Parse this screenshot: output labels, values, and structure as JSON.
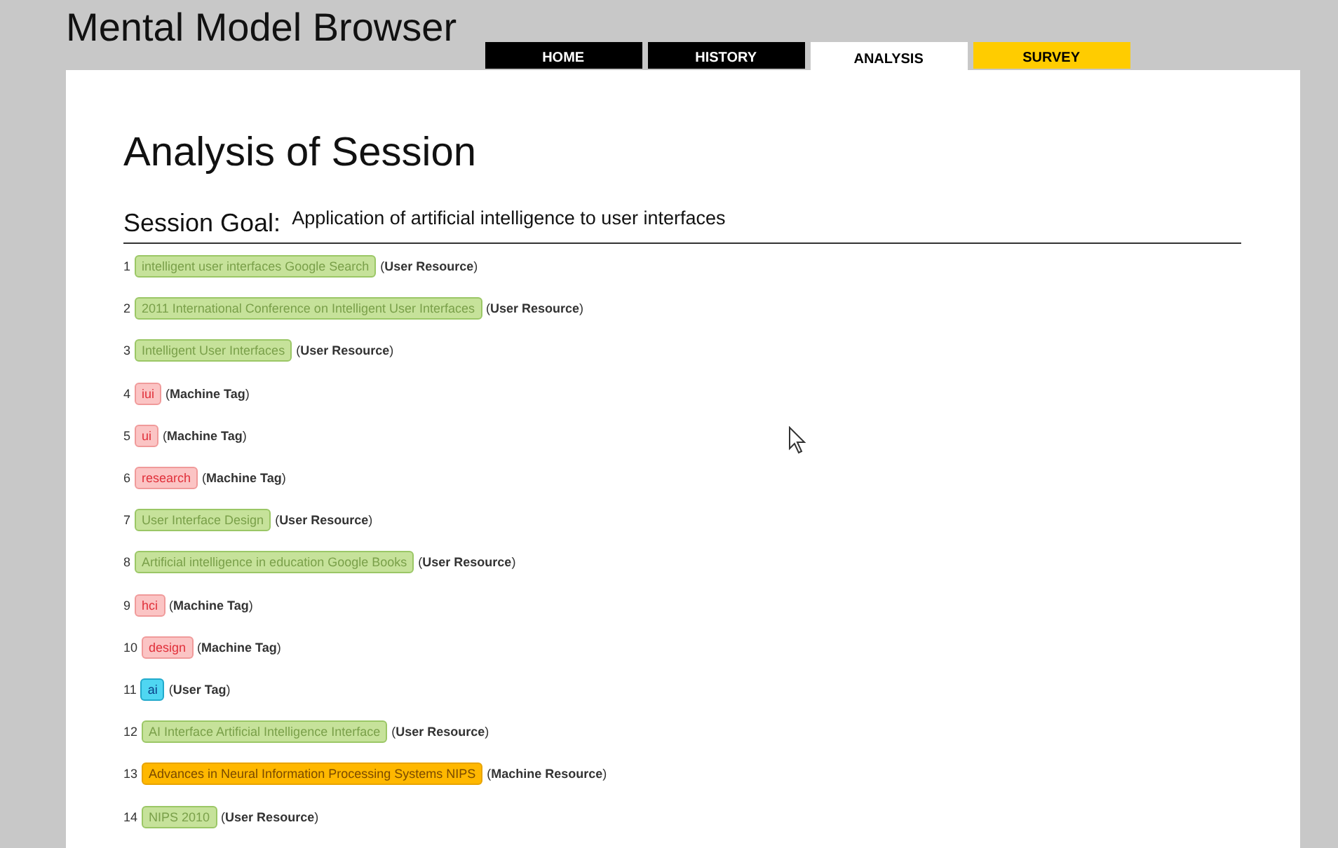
{
  "header": {
    "title": "Mental Model Browser"
  },
  "tabs": [
    {
      "label": "HOME",
      "selected": false,
      "color": "#000000"
    },
    {
      "label": "HISTORY",
      "selected": false,
      "color": "#000000"
    },
    {
      "label": "ANALYSIS",
      "selected": true
    },
    {
      "label": "SURVEY",
      "selected": false,
      "color": "#ffcc00"
    }
  ],
  "heading": "Analysis of Session",
  "session_goal": {
    "label": "Session Goal:",
    "value": "Application of artificial intelligence to user interfaces"
  },
  "items": [
    {
      "number": "1",
      "text": "intelligent user interfaces Google Search",
      "kind": "user_resource",
      "type": "(**User Resource**)"
    },
    {
      "number": "2",
      "text": "2011 International Conference on Intelligent User Interfaces",
      "kind": "user_resource",
      "type": "(**User Resource**)"
    },
    {
      "number": "3",
      "text": "Intelligent User Interfaces",
      "kind": "user_resource",
      "type": "(**User Resource**)"
    },
    {
      "number": "4",
      "text": "iui",
      "kind": "machine_tag",
      "type": "(**Machine Tag**)"
    },
    {
      "number": "5",
      "text": "ui",
      "kind": "machine_tag",
      "type": "(**Machine Tag**)"
    },
    {
      "number": "6",
      "text": "research",
      "kind": "machine_tag",
      "type": "(**Machine Tag**)"
    },
    {
      "number": "7",
      "text": "User Interface Design",
      "kind": "user_resource",
      "type": "(**User Resource**)"
    },
    {
      "number": "8",
      "text": "Artificial intelligence in education Google Books",
      "kind": "user_resource",
      "type": "(**User Resource**)"
    },
    {
      "number": "9",
      "text": "hci",
      "kind": "machine_tag",
      "type": "(**Machine Tag**)"
    },
    {
      "number": "10",
      "text": "design",
      "kind": "machine_tag",
      "type": "(**Machine Tag**)"
    },
    {
      "number": "11",
      "text": "ai",
      "kind": "user_tag",
      "type": "(**User Tag**)"
    },
    {
      "number": "12",
      "text": "AI Interface Artificial Intelligence Interface",
      "kind": "user_resource",
      "type": "(**User Resource**)"
    },
    {
      "number": "13",
      "text": "Advances in Neural Information Processing Systems NIPS",
      "kind": "machine_resource",
      "type": "(**Machine Resource**)"
    },
    {
      "number": "14",
      "text": "NIPS 2010",
      "kind": "user_resource",
      "type": "(**User Resource**)"
    }
  ]
}
